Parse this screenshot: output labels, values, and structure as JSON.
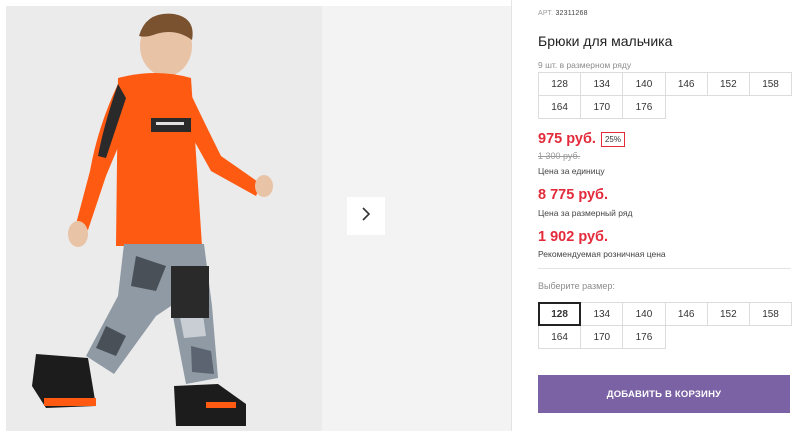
{
  "product": {
    "article_label": "АРТ.",
    "article_number": "32311268",
    "title": "Брюки для мальчика"
  },
  "pack": {
    "note": "9 шт. в размерном ряду",
    "sizes": [
      "128",
      "134",
      "140",
      "146",
      "152",
      "158",
      "164",
      "170",
      "176"
    ]
  },
  "pricing": {
    "unit_price": "975 руб.",
    "discount_badge": "25%",
    "old_price": "1 300 руб.",
    "unit_label": "Цена за единицу",
    "row_price": "8 775 руб.",
    "row_label": "Цена за размерный ряд",
    "retail_price": "1 902 руб.",
    "retail_label": "Рекомендуемая розничная цена"
  },
  "size_picker": {
    "label": "Выберите размер:",
    "sizes": [
      "128",
      "134",
      "140",
      "146",
      "152",
      "158",
      "164",
      "170",
      "176"
    ],
    "selected": "128"
  },
  "cart": {
    "button_label": "ДОБАВИТЬ В КОРЗИНУ"
  },
  "icons": {
    "next": "chevron-right-icon"
  },
  "colors": {
    "price_red": "#e32b3b",
    "cart_button": "#7b62a4",
    "shirt_orange": "#ff5a12"
  }
}
